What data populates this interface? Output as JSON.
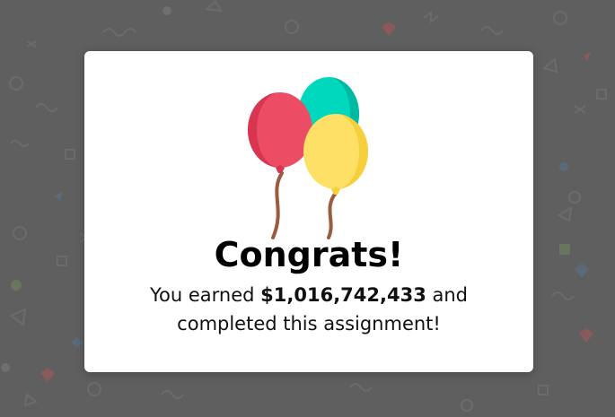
{
  "modal": {
    "title": "Congrats!",
    "message_prefix": "You earned ",
    "amount": "$1,016,742,433",
    "message_suffix": " and completed this assignment!"
  },
  "icons": {
    "balloons": "balloons-icon",
    "background_pattern": "confetti-shapes-pattern"
  },
  "colors": {
    "overlay": "#5f5f5f",
    "modal_bg": "#ffffff",
    "balloon_red": "#ec4d64",
    "balloon_teal": "#00d8bd",
    "balloon_yellow": "#ffe066",
    "string": "#9b5b3f"
  }
}
